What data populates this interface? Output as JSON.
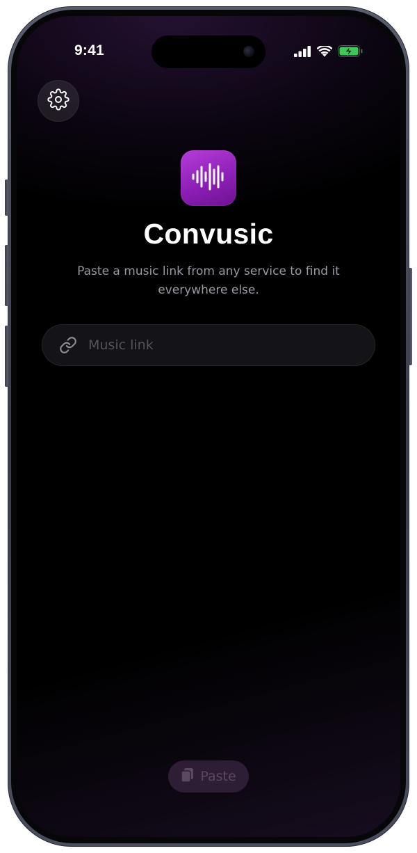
{
  "status_bar": {
    "time": "9:41",
    "icons": [
      "cellular-signal-icon",
      "wifi-icon",
      "battery-charging-icon"
    ],
    "battery_color": "#3ec85a"
  },
  "settings": {
    "icon": "gear-icon"
  },
  "app": {
    "icon": "waveform-icon",
    "title": "Convusic",
    "subtitle": "Paste a music link from any service to find it everywhere else.",
    "accent_color": "#a52fcd"
  },
  "link_field": {
    "icon": "link-icon",
    "placeholder": "Music link",
    "value": ""
  },
  "paste_button": {
    "icon": "clipboard-icon",
    "label": "Paste"
  }
}
